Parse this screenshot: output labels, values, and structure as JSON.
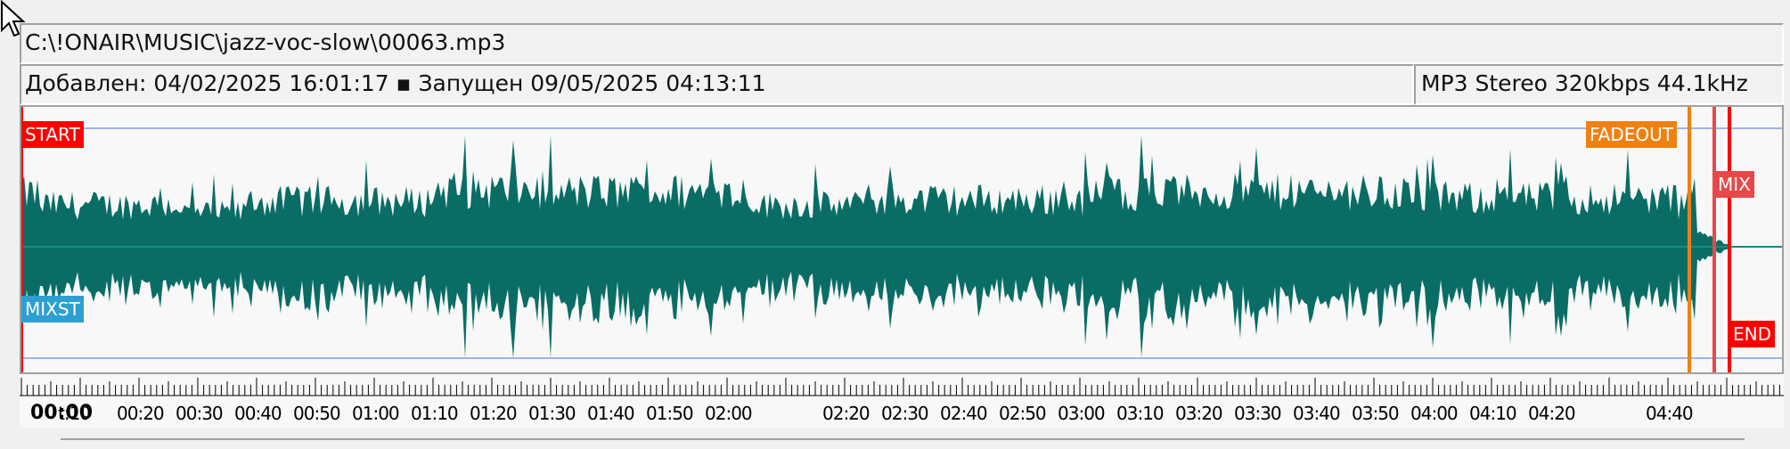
{
  "file": {
    "path": "C:\\!ONAIR\\MUSIC\\jazz-voc-slow\\00063.mp3",
    "info": "Добавлен: 04/02/2025 16:01:17 ▪ Запущен 09/05/2025 04:13:11",
    "format": "MP3 Stereo 320kbps 44.1kHz"
  },
  "colors": {
    "waveform": "#096d65",
    "start": "#ff0000",
    "end": "#ff0000",
    "mix": "#e84848",
    "fadeout": "#f08010",
    "mixst": "#2d9fd2",
    "guide": "#9db4ec"
  },
  "markers": {
    "start": "START",
    "mixst": "MIXST",
    "fadeout": "FADEOUT",
    "mix": "MIX",
    "end": "END"
  },
  "timeline": {
    "current": "00:00",
    "labels": [
      "t:10",
      "00:20",
      "00:30",
      "00:40",
      "00:50",
      "01:00",
      "01:10",
      "01:20",
      "01:30",
      "01:40",
      "01:50",
      "02:00",
      "02:20",
      "02:30",
      "02:40",
      "02:50",
      "03:00",
      "03:10",
      "03:20",
      "03:30",
      "03:40",
      "03:50",
      "04:00",
      "04:10",
      "04:20",
      "04:40"
    ]
  },
  "icons": {
    "cursor": "mouse-pointer-icon"
  }
}
